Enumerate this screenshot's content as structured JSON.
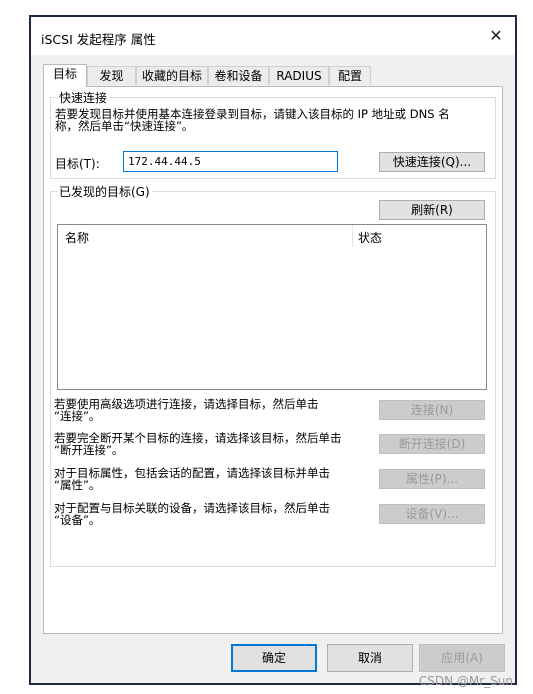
{
  "window": {
    "title": "iSCSI 发起程序 属性",
    "close_glyph": "✕"
  },
  "tabs": [
    {
      "label": "目标",
      "active": true
    },
    {
      "label": "发现"
    },
    {
      "label": "收藏的目标"
    },
    {
      "label": "卷和设备"
    },
    {
      "label": "RADIUS"
    },
    {
      "label": "配置"
    }
  ],
  "quick_connect": {
    "title": "快速连接",
    "description_line1": "若要发现目标并使用基本连接登录到目标，请键入该目标的 IP 地址或 DNS 名",
    "description_line2": "称，然后单击“快速连接”。",
    "target_label": "目标(T):",
    "target_value": "172.44.44.5",
    "button": "快速连接(Q)..."
  },
  "discovered": {
    "title": "已发现的目标(G)",
    "refresh_button": "刷新(R)",
    "columns": [
      "名称",
      "状态"
    ],
    "rows": []
  },
  "actions": [
    {
      "line1": "若要使用高级选项进行连接，请选择目标，然后单击",
      "line2": "“连接”。",
      "button": "连接(N)"
    },
    {
      "line1": "若要完全断开某个目标的连接，请选择该目标，然后单击",
      "line2": "“断开连接”。",
      "button": "断开连接(D)"
    },
    {
      "line1": "对于目标属性，包括会话的配置，请选择该目标并单击",
      "line2": "“属性”。",
      "button": "属性(P)..."
    },
    {
      "line1": "对于配置与目标关联的设备，请选择该目标，然后单击",
      "line2": "“设备”。",
      "button": "设备(V)..."
    }
  ],
  "footer": {
    "ok": "确定",
    "cancel": "取消",
    "apply": "应用(A)"
  },
  "watermark": "CSDN @Mr_Sun"
}
